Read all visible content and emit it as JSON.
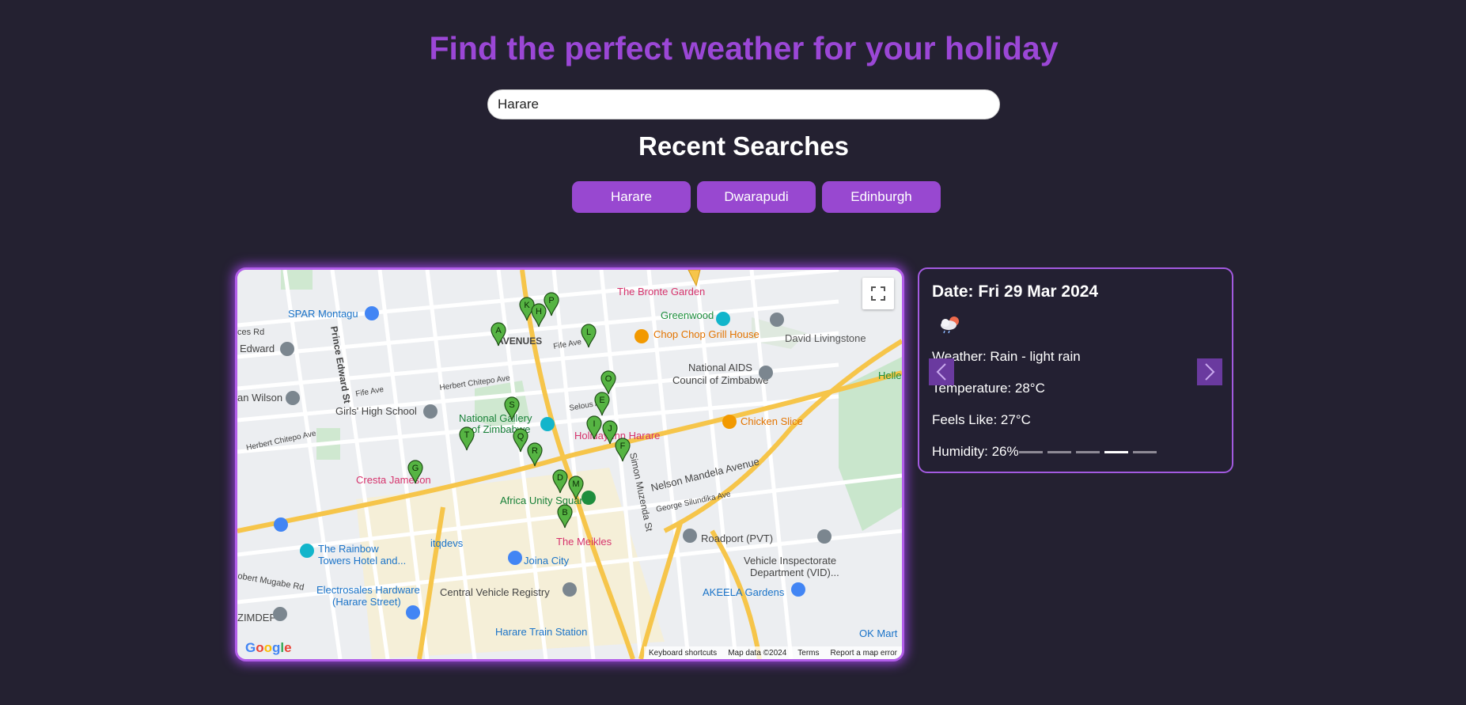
{
  "header": {
    "title": "Find the perfect weather for your holiday"
  },
  "search": {
    "value": "Harare"
  },
  "recent": {
    "title": "Recent Searches",
    "items": [
      "Harare",
      "Dwarapudi",
      "Edinburgh"
    ]
  },
  "map": {
    "provider_logo": "Google",
    "labels": {
      "bronte": "The Bronte Garden",
      "spar": "SPAR Montagu",
      "greenwood": "Greenwood",
      "chopchop": "Chop Chop Grill House",
      "livingstone": "David Livingstone",
      "avenues": "AVENUES",
      "edward": "Edward",
      "aids1": "National AIDS",
      "aids2": "Council of Zimbabwe",
      "wilson": "an Wilson",
      "girls": "Girls' High School",
      "gallery1": "National Gallery",
      "gallery2": "of Zimbabwe",
      "holiday": "Holiday Inn Harare",
      "chicken": "Chicken Slice",
      "cresta": "Cresta Jameson",
      "africa": "Africa Unity Square",
      "nelson": "Nelson Mandela Avenue",
      "meikles": "The Meikles",
      "roadport": "Roadport (PVT)",
      "rainbow1": "The Rainbow",
      "rainbow2": "Towers Hotel and...",
      "itqdevs": "itqdevs",
      "joina": "Joina City",
      "vehicle1": "Vehicle Inspectorate",
      "vehicle2": "Department (VID)...",
      "electro1": "Electrosales Hardware",
      "electro2": "(Harare Street)",
      "cvr": "Central Vehicle Registry",
      "akeela": "AKEELA Gardens",
      "zimdef": "ZIMDEF",
      "station": "Harare Train Station",
      "okmart": "OK Mart",
      "robert": "obert Mugabe Rd",
      "herbert": "Herbert Chitepo Ave",
      "fife": "Fife Ave",
      "prince": "Prince Edward St",
      "selous": "Selous Ave",
      "simon": "Simon Muzenda St",
      "george": "George Silundika Ave",
      "helle": "Helle",
      "parkdrive": "ces Rd"
    },
    "markers": [
      "P",
      "K",
      "H",
      "A",
      "L",
      "O",
      "E",
      "S",
      "I",
      "J",
      "T",
      "Q",
      "R",
      "F",
      "G",
      "D",
      "M",
      "B"
    ],
    "attribution": {
      "shortcuts": "Keyboard shortcuts",
      "mapdata": "Map data ©2024",
      "terms": "Terms",
      "report": "Report a map error"
    }
  },
  "weather": {
    "date": "Date: Fri 29 Mar 2024",
    "icon": "rain-cloud-sun-icon",
    "description": "Weather: Rain - light rain",
    "temperature": "Temperature: 28°C",
    "feels_like": "Feels Like: 27°C",
    "humidity": "Humidity: 26%",
    "slide_count": 5,
    "active_slide": 4
  },
  "colors": {
    "background": "#242131",
    "accent": "#9b47d6",
    "button": "#9848d0"
  }
}
